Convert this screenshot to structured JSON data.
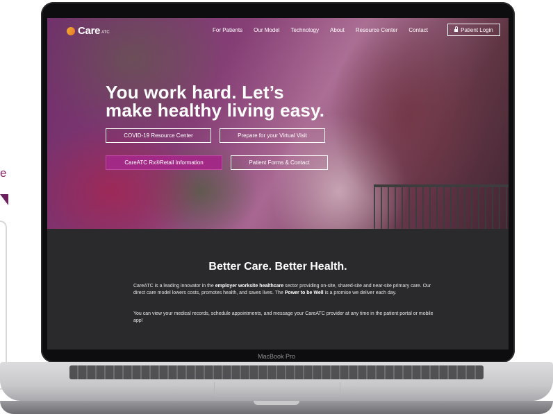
{
  "side_fragment": {
    "letter": "e"
  },
  "device": {
    "label": "MacBook Pro"
  },
  "site": {
    "logo": {
      "name": "Care",
      "sub": "ATC"
    },
    "nav": {
      "items": [
        "For Patients",
        "Our Model",
        "Technology",
        "About",
        "Resource Center",
        "Contact"
      ],
      "login_label": "Patient Login"
    },
    "hero": {
      "headline_line1": "You work hard. Let’s",
      "headline_line2": "make healthy living easy.",
      "buttons": [
        "COVID-19 Resource Center",
        "Prepare for your Virtual Visit",
        "CareATC Rx®Retail Information",
        "Patient Forms & Contact"
      ]
    },
    "about": {
      "title": "Better Care. Better Health.",
      "p1_a": "CareATC is a leading innovator in the ",
      "p1_b": "employer worksite healthcare",
      "p1_c": " sector providing on-site, shared-site and near-site primary care. Our direct care model lowers costs, promotes health, and saves lives. The ",
      "p1_d": "Power to be Well",
      "p1_e": " is a promise we deliver each day.",
      "p2": "You can view your medical records, schedule appointments, and message your CareATC provider at any time in the patient portal or mobile app!"
    }
  },
  "colors": {
    "accent": "#a22a86",
    "logo_orange": "#f3b232",
    "dark_bg": "#2a2a2c"
  }
}
